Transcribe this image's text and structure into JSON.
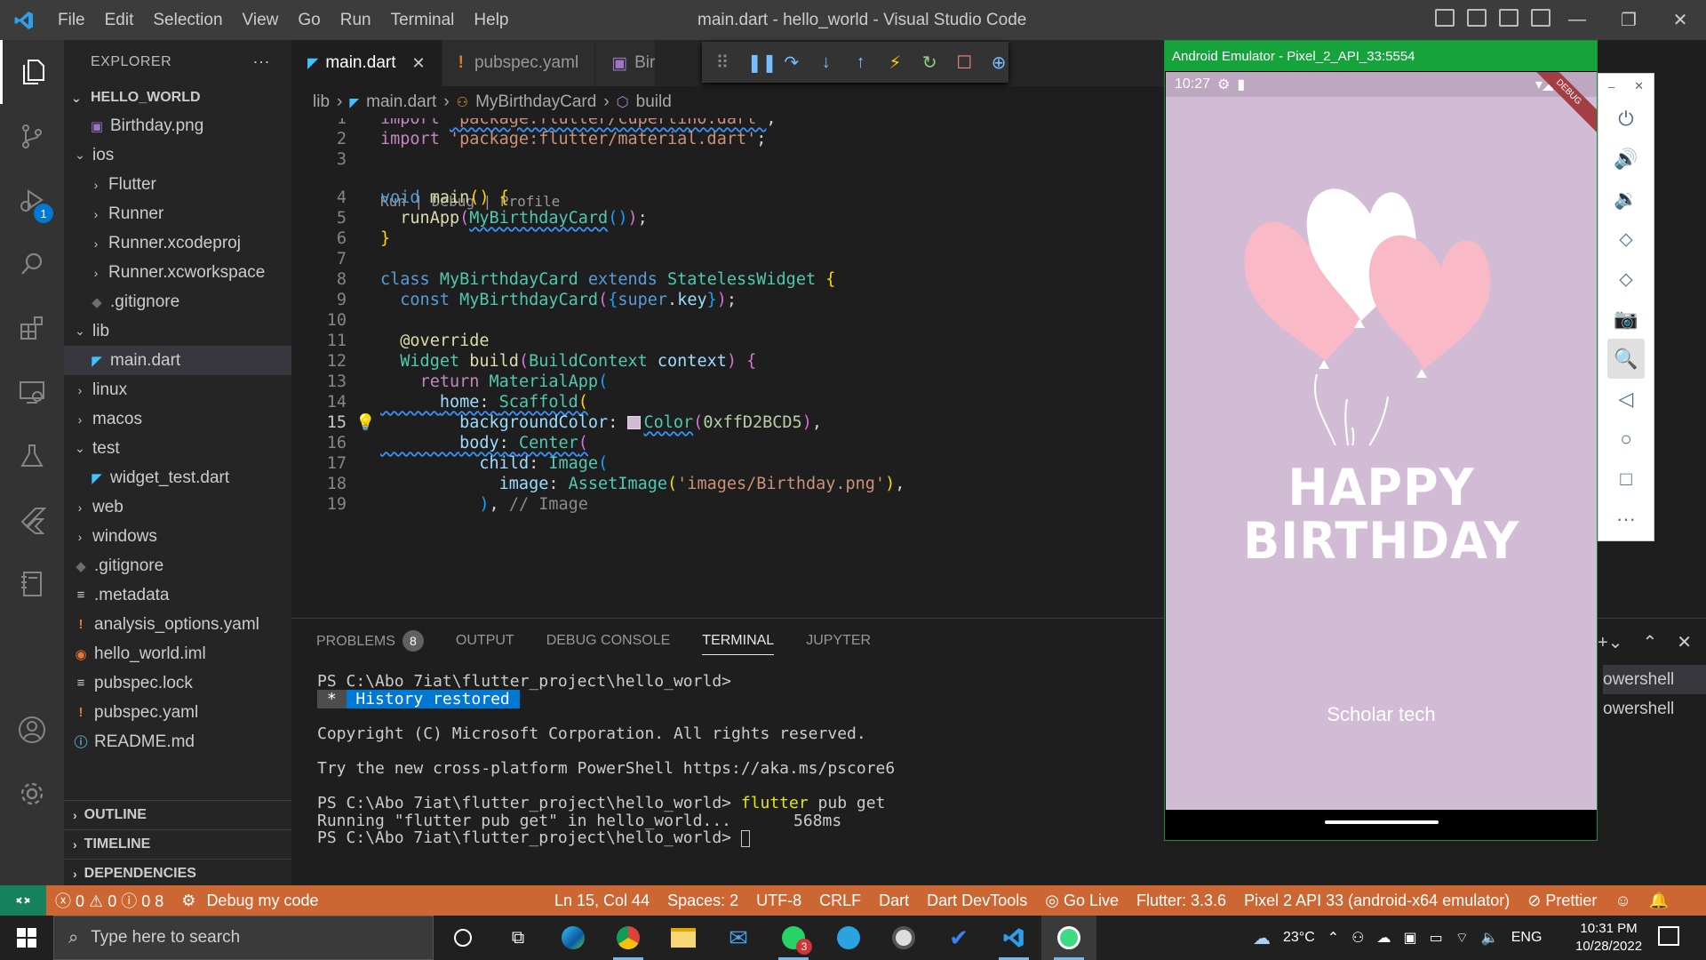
{
  "titlebar": {
    "menu": [
      "File",
      "Edit",
      "Selection",
      "View",
      "Go",
      "Run",
      "Terminal",
      "Help"
    ],
    "title": "main.dart - hello_world - Visual Studio Code"
  },
  "activity": {
    "debug_badge": "1"
  },
  "explorer": {
    "header": "EXPLORER",
    "more": "···",
    "project": "HELLO_WORLD",
    "items": [
      {
        "label": "Birthday.png",
        "indent": 1,
        "chev": "",
        "icon": "image"
      },
      {
        "label": "ios",
        "indent": 0,
        "chev": "open",
        "icon": ""
      },
      {
        "label": "Flutter",
        "indent": 1,
        "chev": "closed",
        "icon": ""
      },
      {
        "label": "Runner",
        "indent": 1,
        "chev": "closed",
        "icon": ""
      },
      {
        "label": "Runner.xcodeproj",
        "indent": 1,
        "chev": "closed",
        "icon": ""
      },
      {
        "label": "Runner.xcworkspace",
        "indent": 1,
        "chev": "closed",
        "icon": ""
      },
      {
        "label": ".gitignore",
        "indent": 1,
        "chev": "",
        "icon": "git"
      },
      {
        "label": "lib",
        "indent": 0,
        "chev": "open",
        "icon": ""
      },
      {
        "label": "main.dart",
        "indent": 1,
        "chev": "",
        "icon": "dart",
        "selected": true
      },
      {
        "label": "linux",
        "indent": 0,
        "chev": "closed",
        "icon": ""
      },
      {
        "label": "macos",
        "indent": 0,
        "chev": "closed",
        "icon": ""
      },
      {
        "label": "test",
        "indent": 0,
        "chev": "open",
        "icon": ""
      },
      {
        "label": "widget_test.dart",
        "indent": 1,
        "chev": "",
        "icon": "dart"
      },
      {
        "label": "web",
        "indent": 0,
        "chev": "closed",
        "icon": ""
      },
      {
        "label": "windows",
        "indent": 0,
        "chev": "closed",
        "icon": ""
      },
      {
        "label": ".gitignore",
        "indent": 0,
        "chev": "",
        "icon": "git"
      },
      {
        "label": ".metadata",
        "indent": 0,
        "chev": "",
        "icon": "lines"
      },
      {
        "label": "analysis_options.yaml",
        "indent": 0,
        "chev": "",
        "icon": "yaml"
      },
      {
        "label": "hello_world.iml",
        "indent": 0,
        "chev": "",
        "icon": "rss"
      },
      {
        "label": "pubspec.lock",
        "indent": 0,
        "chev": "",
        "icon": "lines"
      },
      {
        "label": "pubspec.yaml",
        "indent": 0,
        "chev": "",
        "icon": "yaml"
      },
      {
        "label": "README.md",
        "indent": 0,
        "chev": "",
        "icon": "info"
      }
    ],
    "sections": [
      "OUTLINE",
      "TIMELINE",
      "DEPENDENCIES"
    ]
  },
  "tabs": [
    {
      "label": "main.dart",
      "active": true,
      "close": "✕"
    },
    {
      "label": "pubspec.yaml",
      "active": false,
      "close": ""
    },
    {
      "label": "Bir",
      "active": false,
      "close": ""
    }
  ],
  "breadcrumb": [
    "lib",
    "main.dart",
    "MyBirthdayCard",
    "build"
  ],
  "codelens": "Run | Debug | Profile",
  "code": {
    "line_numbers": [
      "1",
      "2",
      "3",
      "4",
      "5",
      "6",
      "7",
      "8",
      "9",
      "10",
      "11",
      "12",
      "13",
      "14",
      "15",
      "16",
      "17",
      "18",
      "19"
    ],
    "current_line": "15"
  },
  "panel": {
    "tabs": [
      "PROBLEMS",
      "OUTPUT",
      "DEBUG CONSOLE",
      "TERMINAL",
      "JUPYTER"
    ],
    "problems_count": "8",
    "active_tab": "TERMINAL",
    "terminal": {
      "prompt1": "PS C:\\Abo 7iat\\flutter_project\\hello_world>",
      "history_star": " * ",
      "history": " History restored ",
      "copyright": "Copyright (C) Microsoft Corporation. All rights reserved.",
      "try": "Try the new cross-platform PowerShell https://aka.ms/pscore6",
      "prompt2": "PS C:\\Abo 7iat\\flutter_project\\hello_world> ",
      "command": "flutter",
      "command_args": " pub get",
      "running": "Running \"flutter pub get\" in hello_world...",
      "time": "568ms",
      "prompt3": "PS C:\\Abo 7iat\\flutter_project\\hello_world> "
    },
    "shells": [
      "owershell",
      "owershell"
    ]
  },
  "statusbar": {
    "errors": "0",
    "warnings": "0",
    "info": "0",
    "problems": "8",
    "debug": "Debug my code",
    "position": "Ln 15, Col 44",
    "spaces": "Spaces: 2",
    "encoding": "UTF-8",
    "eol": "CRLF",
    "language": "Dart",
    "devtools": "Dart DevTools",
    "golive": "Go Live",
    "flutter": "Flutter: 3.3.6",
    "device": "Pixel 2 API 33 (android-x64 emulator)",
    "prettier": "Prettier"
  },
  "emulator": {
    "title": "Android Emulator - Pixel_2_API_33:5554",
    "time": "10:27",
    "ribbon": "DEBUG",
    "happy": "HAPPY",
    "birthday": "BIRTHDAY",
    "subtitle": "Scholar tech",
    "controls": [
      "power-icon",
      "volume-up-icon",
      "volume-down-icon",
      "rotate-left-icon",
      "rotate-right-icon",
      "camera-icon",
      "zoom-icon",
      "back-icon",
      "home-icon",
      "overview-icon",
      "more-icon"
    ],
    "background": "#D2BCD5"
  },
  "taskbar": {
    "search": "Type here to search",
    "whatsapp_badge": "3",
    "weather": "23°C",
    "lang": "ENG",
    "time": "10:31 PM",
    "date": "10/28/2022"
  },
  "colors": {
    "statusbar": "#cc6633",
    "remote": "#16825d",
    "accent": "#0078d4",
    "emulator_title": "#16a33b"
  }
}
